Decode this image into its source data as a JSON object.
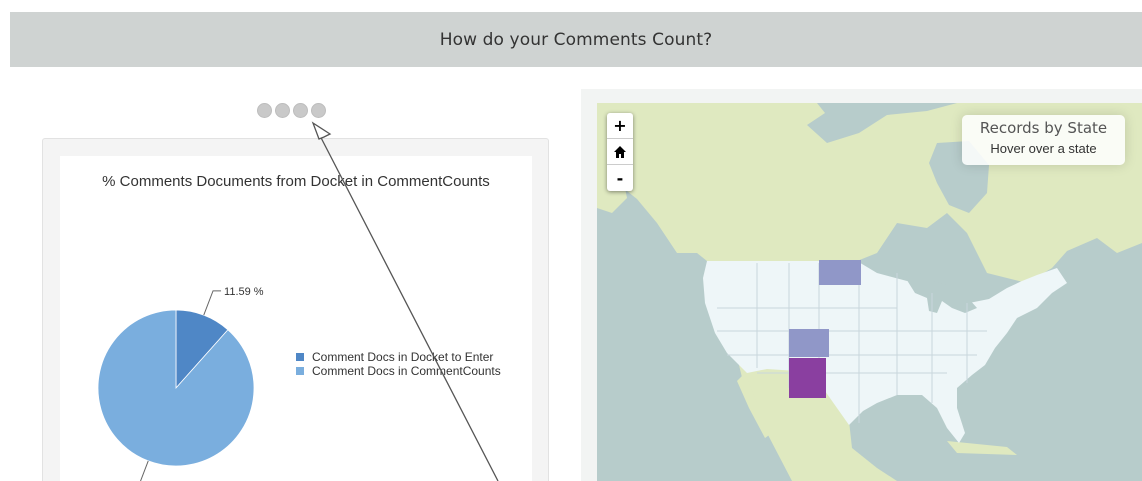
{
  "banner": {
    "title": "How do your Comments Count?"
  },
  "carousel": {
    "dots": 4
  },
  "pie_chart": {
    "title": "% Comments Documents from Docket in CommentCounts",
    "slice_labels": [
      "11.59 %",
      ""
    ],
    "legend": [
      {
        "label": "Comment Docs in Docket to Enter",
        "color": "#4f87c6"
      },
      {
        "label": "Comment Docs in CommentCounts",
        "color": "#7aaede"
      }
    ]
  },
  "chart_data": {
    "type": "pie",
    "title": "% Comments Documents from Docket in CommentCounts",
    "categories": [
      "Comment Docs in Docket to Enter",
      "Comment Docs in CommentCounts"
    ],
    "values": [
      11.59,
      88.41
    ],
    "colors": [
      "#4f87c6",
      "#7aaede"
    ],
    "legend_position": "right"
  },
  "map": {
    "zoom_in_label": "+",
    "home_icon": "home-icon",
    "zoom_out_label": "-",
    "legend_title": "Records by State",
    "legend_hint": "Hover over a state",
    "colors": {
      "ocean": "#b7cccb",
      "land": "#dfe9c0",
      "us": "#eef6f8",
      "lake": "#b7cccb",
      "state_low": "#9097c8",
      "state_high": "#8a3fa0"
    },
    "highlighted_states": [
      "North Dakota",
      "Colorado",
      "New Mexico"
    ]
  }
}
